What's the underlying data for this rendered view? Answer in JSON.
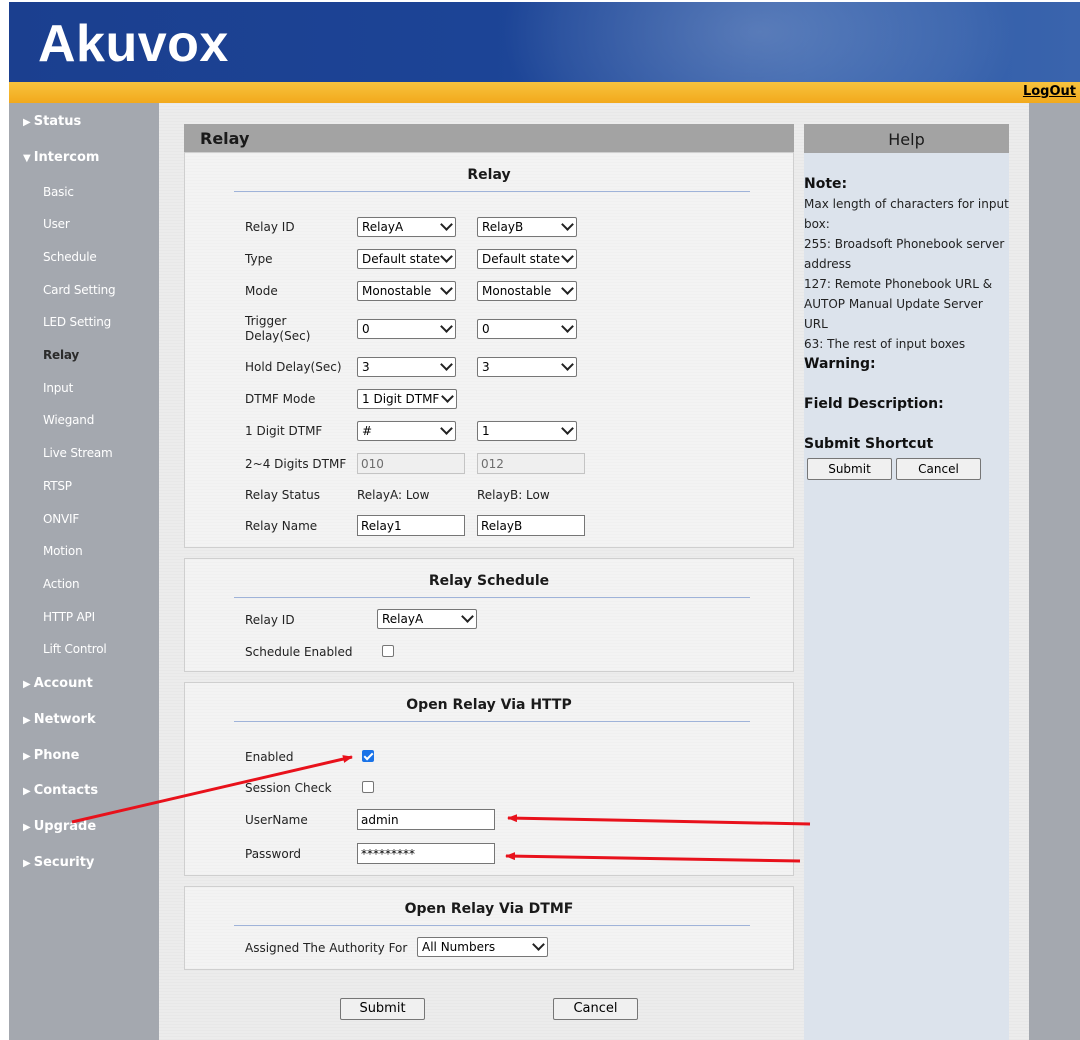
{
  "header": {
    "logo_text": "Akuvox",
    "logout_label": "LogOut"
  },
  "sidebar": {
    "status": "Status",
    "intercom": "Intercom",
    "intercom_items": [
      "Basic",
      "User",
      "Schedule",
      "Card Setting",
      "LED Setting",
      "Relay",
      "Input",
      "Wiegand",
      "Live Stream",
      "RTSP",
      "ONVIF",
      "Motion",
      "Action",
      "HTTP API",
      "Lift Control"
    ],
    "active_item": "Relay",
    "account": "Account",
    "network": "Network",
    "phone": "Phone",
    "contacts": "Contacts",
    "upgrade": "Upgrade",
    "security": "Security"
  },
  "page": {
    "title": "Relay"
  },
  "relay": {
    "section_title": "Relay",
    "relay_id_label": "Relay ID",
    "relay_id_a": "RelayA",
    "relay_id_b": "RelayB",
    "type_label": "Type",
    "type_a": "Default state",
    "type_b": "Default state",
    "mode_label": "Mode",
    "mode_a": "Monostable",
    "mode_b": "Monostable",
    "trigger_delay_label": "Trigger Delay(Sec)",
    "trigger_delay_a": "0",
    "trigger_delay_b": "0",
    "hold_delay_label": "Hold Delay(Sec)",
    "hold_delay_a": "3",
    "hold_delay_b": "3",
    "dtmf_mode_label": "DTMF Mode",
    "dtmf_mode": "1 Digit DTMF",
    "one_digit_label": "1 Digit DTMF",
    "one_digit_a": "#",
    "one_digit_b": "1",
    "multi_digit_label": "2~4 Digits DTMF",
    "multi_digit_a": "010",
    "multi_digit_b": "012",
    "status_label": "Relay Status",
    "status_a": "RelayA: Low",
    "status_b": "RelayB: Low",
    "name_label": "Relay Name",
    "name_a": "Relay1",
    "name_b": "RelayB"
  },
  "schedule": {
    "section_title": "Relay Schedule",
    "relay_id_label": "Relay ID",
    "relay_id": "RelayA",
    "enabled_label": "Schedule Enabled",
    "enabled": false
  },
  "http": {
    "section_title": "Open Relay Via HTTP",
    "enabled_label": "Enabled",
    "enabled": true,
    "session_check_label": "Session Check",
    "session_check": false,
    "username_label": "UserName",
    "username": "admin",
    "password_label": "Password",
    "password": "*********"
  },
  "dtmf": {
    "section_title": "Open Relay Via DTMF",
    "authority_label": "Assigned The Authority For",
    "authority": "All Numbers"
  },
  "actions": {
    "submit": "Submit",
    "cancel": "Cancel"
  },
  "help": {
    "title": "Help",
    "note_heading": "Note:",
    "note_lines": [
      "Max length of characters for input",
      "box:",
      "255: Broadsoft Phonebook server",
      "address",
      "127: Remote Phonebook URL &",
      "AUTOP Manual Update Server URL",
      "63: The rest of input boxes"
    ],
    "warning_heading": "Warning:",
    "field_desc_heading": "Field Description:",
    "shortcut_heading": "Submit Shortcut",
    "submit": "Submit",
    "cancel": "Cancel"
  },
  "colors": {
    "header_blue": "#1c4496",
    "orange": "#f2a91c",
    "sidebar": "#a4a8af",
    "help_bg": "#dce3ec",
    "annotation_red": "#e8111b"
  }
}
